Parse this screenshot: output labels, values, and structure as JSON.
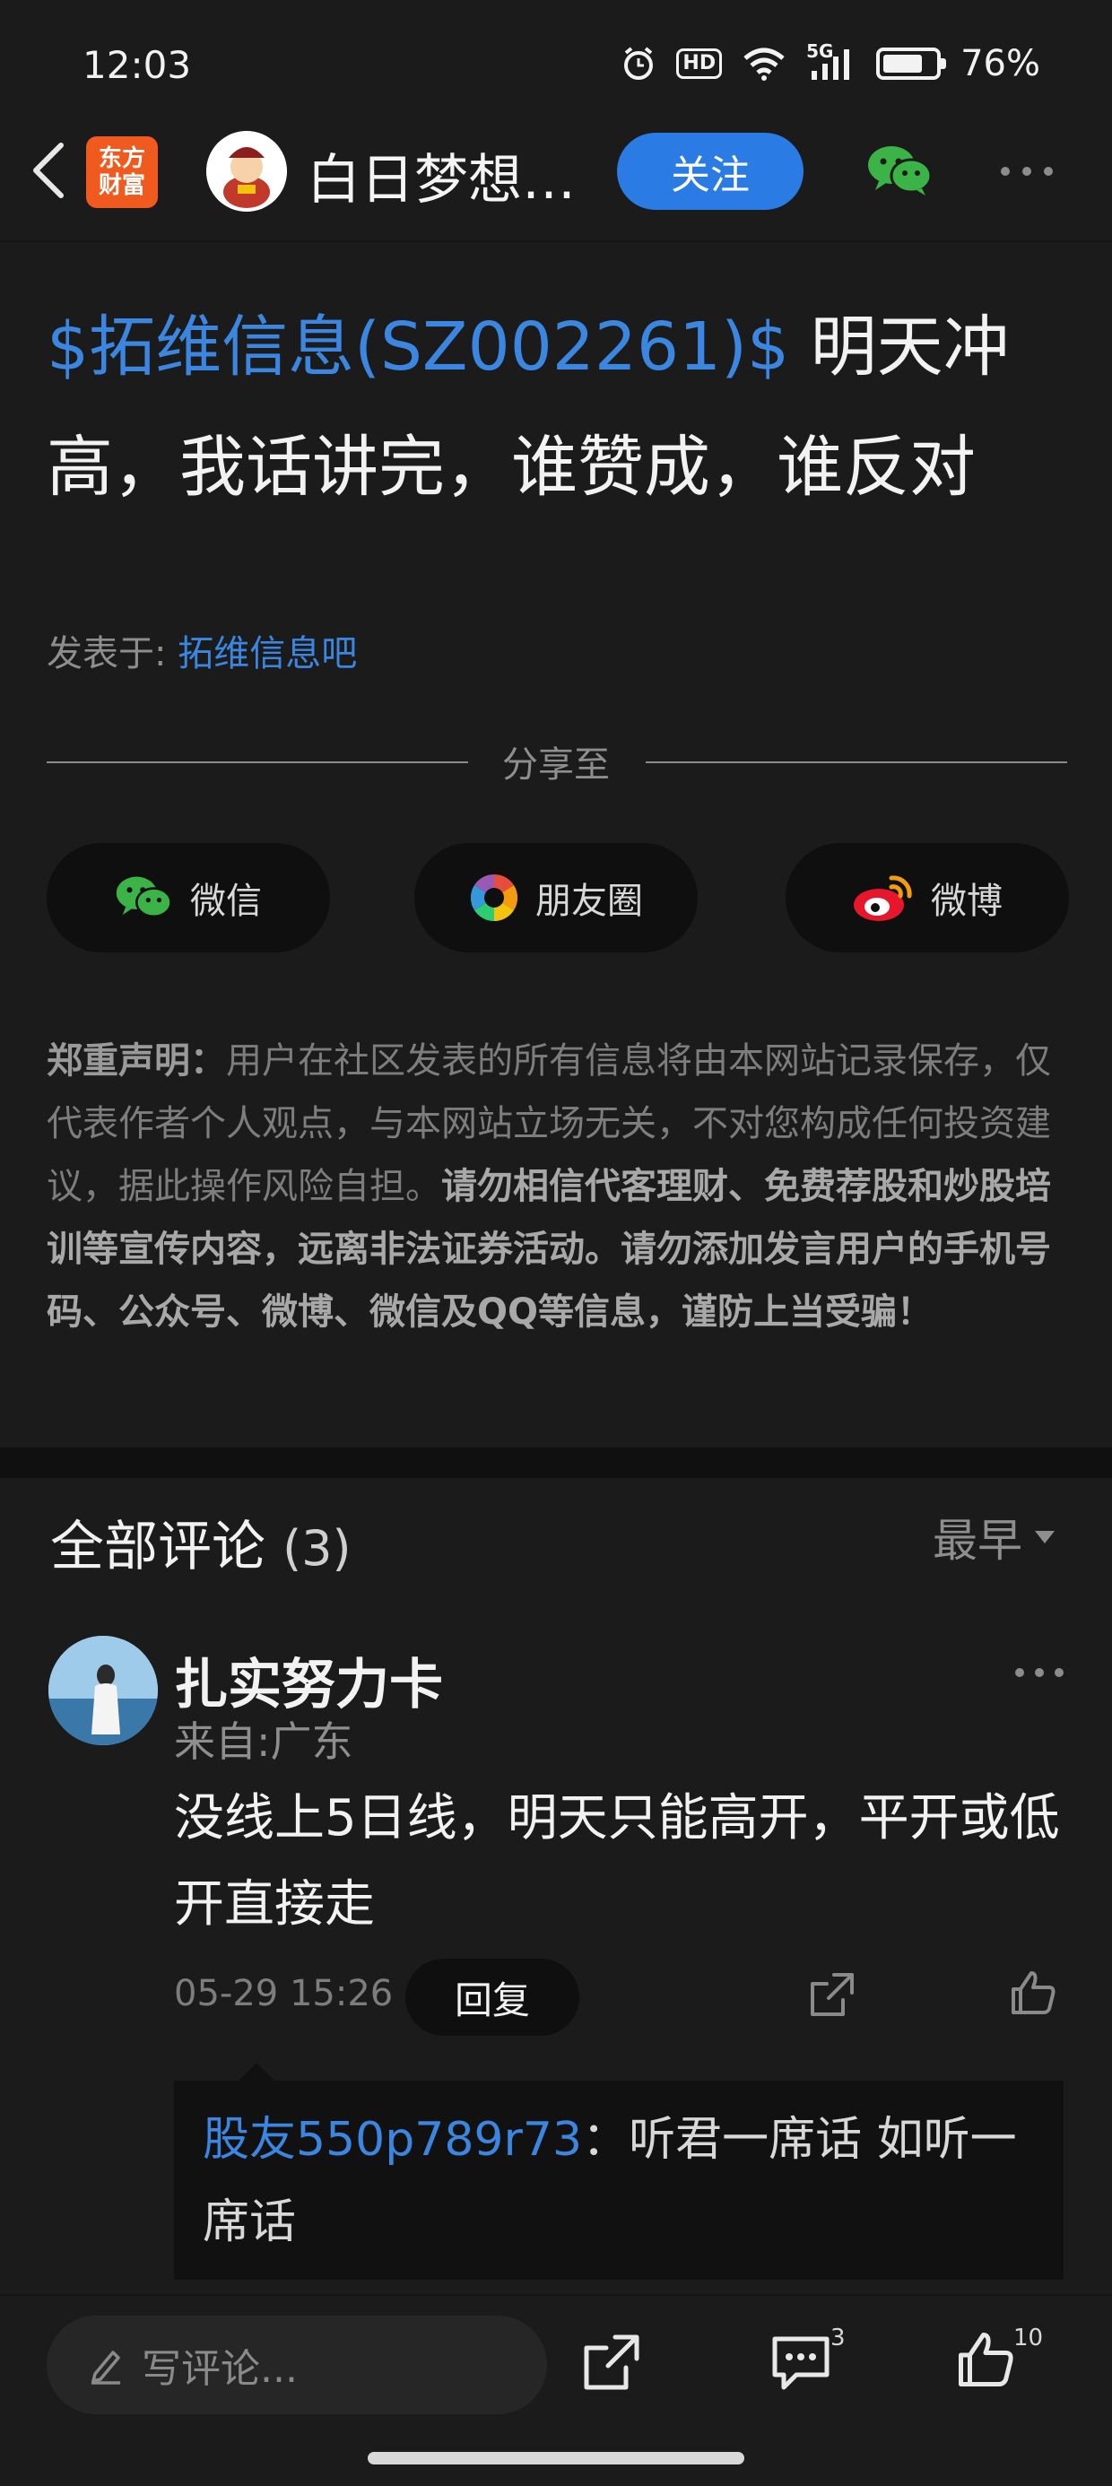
{
  "status_bar": {
    "time": "12:03",
    "network": "5G",
    "hd": "HD",
    "battery": "76%",
    "battery_level": 0.76,
    "icons": [
      "alarm-icon",
      "hd-icon",
      "wifi-icon",
      "signal-5g-icon",
      "battery-icon"
    ]
  },
  "header": {
    "back_icon": "chevron-left-icon",
    "app_logo_line1": "东方",
    "app_logo_line2": "财富",
    "author_name": "白日梦想…",
    "follow_label": "关注",
    "wechat_icon": "wechat-icon",
    "more_icon": "more-dots-icon"
  },
  "post": {
    "stock_tag": "$拓维信息(SZ002261)$",
    "title_text": " 明天冲高，我话讲完，谁赞成，谁反对",
    "posted_in_label": "发表于: ",
    "forum_name": "拓维信息吧"
  },
  "share": {
    "label": "分享至",
    "buttons": [
      {
        "label": "微信",
        "icon": "wechat-icon"
      },
      {
        "label": "朋友圈",
        "icon": "moments-icon"
      },
      {
        "label": "微博",
        "icon": "weibo-icon"
      }
    ]
  },
  "disclaimer": {
    "heading": "郑重声明",
    "colon": "：",
    "normal_text": "用户在社区发表的所有信息将由本网站记录保存，仅代表作者个人观点，与本网站立场无关，不对您构成任何投资建议，据此操作风险自担。",
    "bold_text": "请勿相信代客理财、免费荐股和炒股培训等宣传内容，远离非法证券活动。请勿添加发言用户的手机号码、公众号、微博、微信及QQ等信息，谨防上当受骗！"
  },
  "comments": {
    "title": "全部评论",
    "count": "(3)",
    "sort_label": "最早",
    "items": [
      {
        "user": "扎实努力卡",
        "location": "来自:广东",
        "body": "没线上5日线，明天只能高开，平开或低开直接走",
        "time": "05-29 15:26",
        "reply_label": "回复",
        "replies": [
          {
            "user": "股友550p789r73",
            "separator": "：",
            "text": "听君一席话 如听一席话"
          }
        ]
      }
    ]
  },
  "bottom_bar": {
    "input_placeholder": "写评论...",
    "comment_count": "3",
    "like_count": "10"
  },
  "colors": {
    "background": "#1b1b1b",
    "accent_blue": "#3a86e0",
    "follow_button": "#2a7be4",
    "logo_orange": "#f05a1e"
  }
}
